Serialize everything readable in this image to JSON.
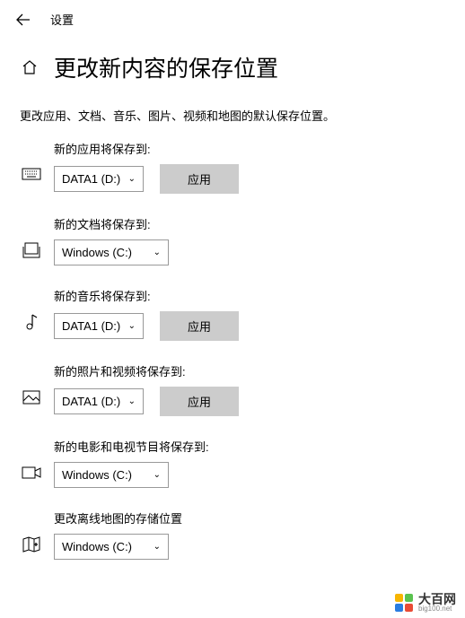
{
  "header": {
    "title": "设置"
  },
  "page": {
    "title": "更改新内容的保存位置",
    "description": "更改应用、文档、音乐、图片、视频和地图的默认保存位置。"
  },
  "settings": {
    "apps": {
      "label": "新的应用将保存到:",
      "value": "DATA1 (D:)",
      "apply": "应用"
    },
    "documents": {
      "label": "新的文档将保存到:",
      "value": "Windows (C:)"
    },
    "music": {
      "label": "新的音乐将保存到:",
      "value": "DATA1 (D:)",
      "apply": "应用"
    },
    "photos": {
      "label": "新的照片和视频将保存到:",
      "value": "DATA1 (D:)",
      "apply": "应用"
    },
    "movies": {
      "label": "新的电影和电视节目将保存到:",
      "value": "Windows (C:)"
    },
    "maps": {
      "label": "更改离线地图的存储位置",
      "value": "Windows (C:)"
    }
  },
  "watermark": {
    "name": "大百网",
    "url": "big100.net",
    "colors": [
      "#f7b500",
      "#5ac24f",
      "#2a7de1",
      "#e94b35"
    ]
  }
}
